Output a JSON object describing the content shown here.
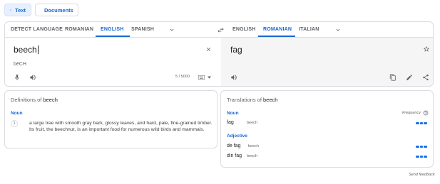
{
  "mode_tabs": {
    "text": "Text",
    "documents": "Documents"
  },
  "source_languages": [
    "DETECT LANGUAGE",
    "ROMANIAN",
    "ENGLISH",
    "SPANISH"
  ],
  "source_selected": "ENGLISH",
  "target_languages": [
    "ENGLISH",
    "ROMANIAN",
    "ITALIAN"
  ],
  "target_selected": "ROMANIAN",
  "source": {
    "text": "beech",
    "transliteration": "bēCH",
    "char_count": "5 / 5000"
  },
  "target": {
    "text": "fag"
  },
  "definitions": {
    "title_prefix": "Definitions of",
    "word": "beech",
    "pos": "Noun",
    "items": [
      {
        "num": "1",
        "text": "a large tree with smooth gray bark, glossy leaves, and hard, pale, fine-grained timber. Its fruit, the beechnut, is an important food for numerous wild birds and mammals."
      }
    ]
  },
  "translations": {
    "title_prefix": "Translations of",
    "word": "beech",
    "frequency_label": "Frequency",
    "groups": [
      {
        "pos": "Noun",
        "rows": [
          {
            "word": "fag",
            "back": "beech",
            "frequency": 1.0
          }
        ]
      },
      {
        "pos": "Adjective",
        "rows": [
          {
            "word": "de fag",
            "back": "beech",
            "frequency": 1.0
          },
          {
            "word": "din fag",
            "back": "beech",
            "frequency": 1.0
          }
        ]
      }
    ]
  },
  "feedback": "Send feedback",
  "colors": {
    "accent": "#1967d2",
    "frequency_bar": "#1a73e8",
    "target_panel_bg": "#f5f5f5"
  },
  "icons": [
    "translate-icon",
    "document-icon",
    "chevron-down-icon",
    "swap-icon",
    "close-icon",
    "microphone-icon",
    "speaker-icon",
    "keyboard-icon",
    "star-icon",
    "copy-icon",
    "edit-icon",
    "share-icon",
    "help-icon"
  ]
}
